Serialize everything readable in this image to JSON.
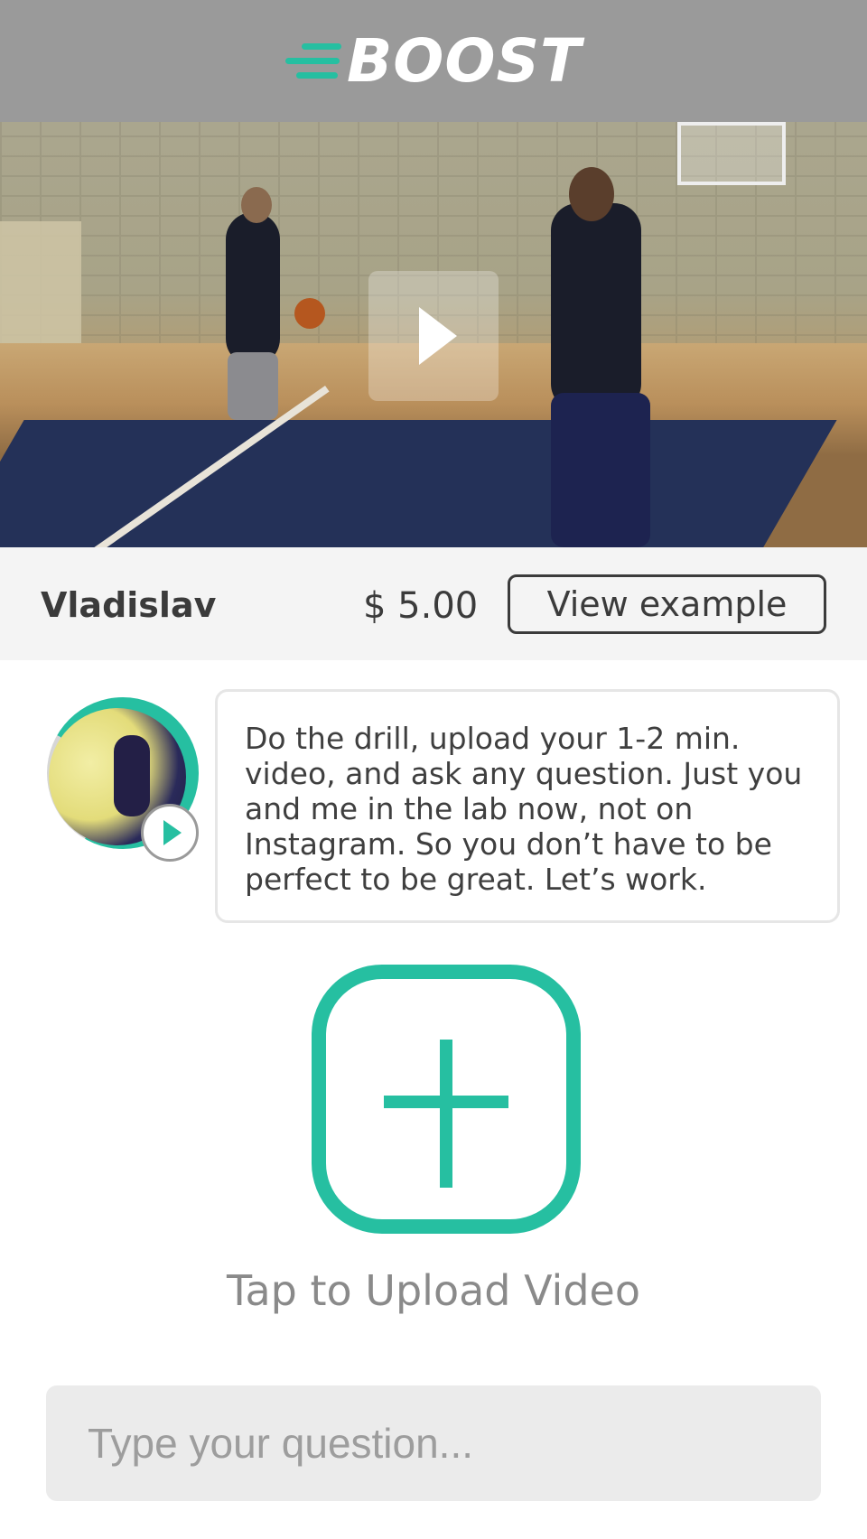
{
  "header": {
    "logo_text": "BOOST",
    "logo_icon": "speed-lines-icon",
    "background": "#9a9a9a"
  },
  "video": {
    "play_icon": "play-icon"
  },
  "info": {
    "coach_name": "Vladislav",
    "price": "$ 5.00",
    "view_example_label": "View example"
  },
  "message": {
    "avatar_play_icon": "play-icon",
    "text": "Do the drill, upload your 1-2 min. video, and ask any question. Just you and me in the lab now, not on Instagram. So you don’t have to be perfect to be great. Let’s work."
  },
  "upload": {
    "icon": "plus-icon",
    "label": "Tap to Upload Video"
  },
  "question": {
    "placeholder": "Type your question...",
    "value": ""
  },
  "colors": {
    "accent": "#26bfa1",
    "text_dark": "#3b3b3b",
    "text_muted": "#8a8a8a"
  }
}
